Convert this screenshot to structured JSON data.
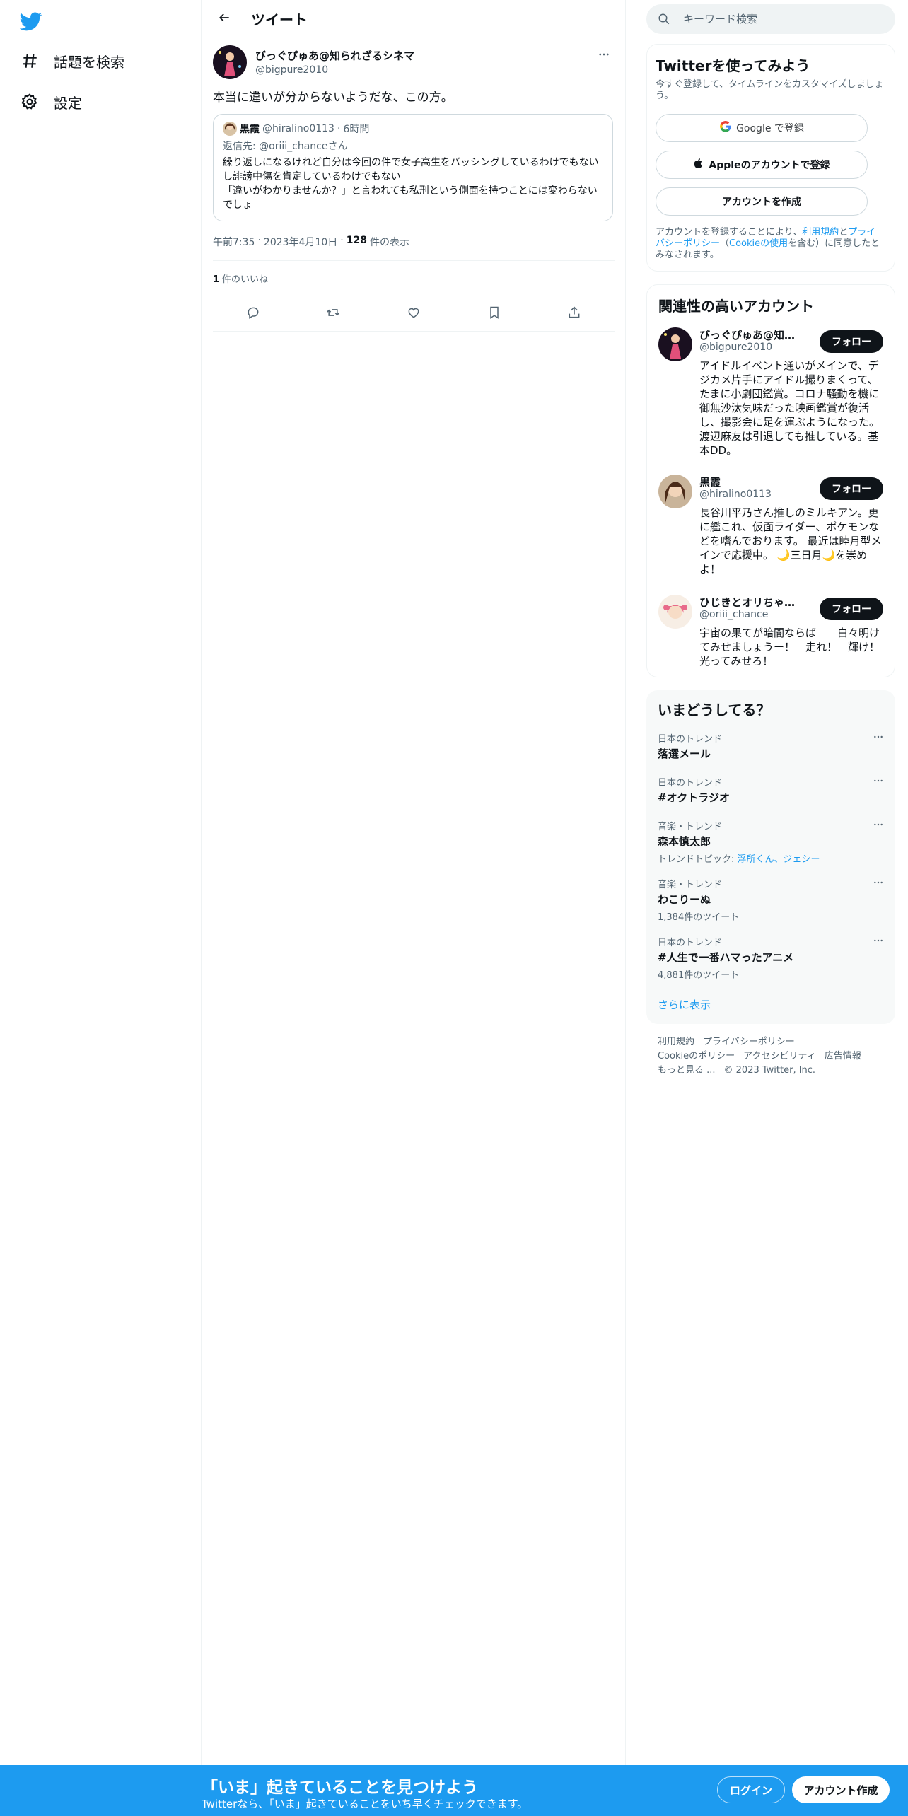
{
  "colors": {
    "accent": "#1d9bf0",
    "text": "#0f1419",
    "muted": "#536471",
    "border": "#eff3f4"
  },
  "nav": {
    "logo_icon": "twitter-bird-icon",
    "items": [
      {
        "label": "話題を検索",
        "icon": "hashtag-icon"
      },
      {
        "label": "設定",
        "icon": "gear-icon"
      }
    ]
  },
  "header": {
    "title": "ツイート",
    "back_icon": "arrow-left-icon"
  },
  "tweet": {
    "name": "びっぐぴゅあ@知られざるシネマ",
    "handle": "@bigpure2010",
    "text": "本当に違いが分からないようだな、この方。",
    "quote": {
      "name": "黒霞",
      "handle": "@hiralino0113",
      "dot": "·",
      "time": "6時間",
      "reply_to": "返信先: @oriii_chanceさん",
      "body": "繰り返しになるけれど自分は今回の件で女子高生をバッシングしているわけでもないし誹謗中傷を肯定しているわけでもない\n「違いがわかりませんか？」と言われても私刑という側面を持つことには変わらないでしょ"
    },
    "time": "午前7:35",
    "date": "2023年4月10日",
    "dot": "·",
    "views_count": "128",
    "views_label": "件の表示",
    "likes_count": "1",
    "likes_label": "件のいいね",
    "actions": [
      "reply-icon",
      "retweet-icon",
      "like-icon",
      "bookmark-icon",
      "share-icon"
    ]
  },
  "search": {
    "placeholder": "キーワード検索"
  },
  "signup": {
    "title": "Twitterを使ってみよう",
    "subtitle": "今すぐ登録して、タイムラインをカスタマイズしましょう。",
    "google_label": "Google で登録",
    "apple_label": "Appleのアカウントで登録",
    "create_label": "アカウントを作成",
    "legal_prefix": "アカウントを登録することにより、",
    "legal_terms": "利用規約",
    "legal_and": "と",
    "legal_privacy": "プライバシーポリシー",
    "legal_open": "（",
    "legal_cookie": "Cookieの使用",
    "legal_suffix": "を含む）に同意したとみなされます。"
  },
  "related": {
    "title": "関連性の高いアカウント",
    "follow_label": "フォロー",
    "accounts": [
      {
        "name": "びっぐぴゅあ@知られざるシネマ",
        "handle": "@bigpure2010",
        "bio": "アイドルイベント通いがメインで、デジカメ片手にアイドル撮りまくって、たまに小劇団鑑賞。コロナ騒動を機に御無沙汰気味だった映画鑑賞が復活し、撮影会に足を運ぶようになった。渡辺麻友は引退しても推している。基本DD。"
      },
      {
        "name": "黒霞",
        "handle": "@hiralino0113",
        "bio": "長谷川平乃さん推しのミルキアン。更に艦これ、仮面ライダー、ポケモンなどを嗜んでおります。 最近は睦月型メインで応援中。 🌙三日月🌙を崇めよ！"
      },
      {
        "name": "ひじきとオリちゃん(ひじきの人)",
        "handle": "@oriii_chance",
        "bio": "宇宙の果てが暗闇ならば　　白々明けてみせましょうー！　走れ！　輝け！光ってみせろ！"
      }
    ]
  },
  "trends": {
    "title": "いまどうしてる？",
    "items": [
      {
        "context": "日本のトレンド",
        "name": "落選メール",
        "sub": ""
      },
      {
        "context": "日本のトレンド",
        "name": "#オクトラジオ",
        "sub": ""
      },
      {
        "context": "音楽・トレンド",
        "name": "森本慎太郎",
        "sub_prefix": "トレンドトピック: ",
        "sub_link": "浮所くん、ジェシー"
      },
      {
        "context": "音楽・トレンド",
        "name": "わこりーぬ",
        "sub": "1,384件のツイート"
      },
      {
        "context": "日本のトレンド",
        "name": "#人生で一番ハマったアニメ",
        "sub": "4,881件のツイート"
      }
    ],
    "show_more": "さらに表示"
  },
  "footer": {
    "links": [
      "利用規約",
      "プライバシーポリシー",
      "Cookieのポリシー",
      "アクセシビリティ",
      "広告情報",
      "もっと見る ...",
      "© 2023 Twitter, Inc."
    ]
  },
  "bottom_bar": {
    "title": "「いま」起きていることを見つけよう",
    "subtitle": "Twitterなら、「いま」起きていることをいち早くチェックできます。",
    "login": "ログイン",
    "signup": "アカウント作成"
  }
}
